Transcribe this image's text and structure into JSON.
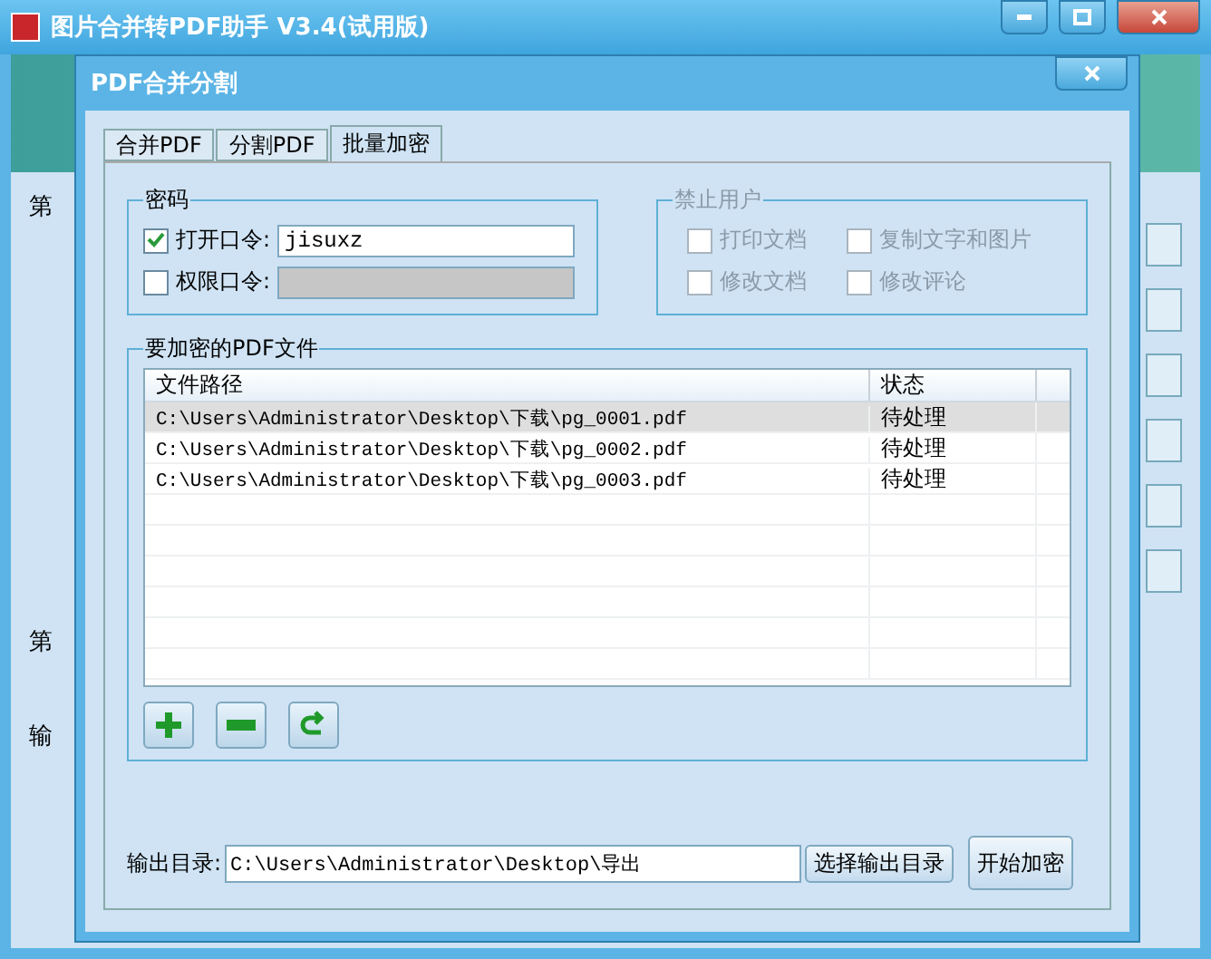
{
  "main_window": {
    "title": "图片合并转PDF助手 V3.4(试用版)",
    "fragments": [
      "第",
      "第",
      "输"
    ]
  },
  "dialog": {
    "title": "PDF合并分割"
  },
  "tabs": [
    {
      "label": "合并PDF",
      "selected": false
    },
    {
      "label": "分割PDF",
      "selected": false
    },
    {
      "label": "批量加密",
      "selected": true
    }
  ],
  "password": {
    "title": "密码",
    "fields": [
      {
        "label": "打开口令:",
        "checked": true,
        "value": "jisuxz"
      },
      {
        "label": "权限口令:",
        "checked": false
      }
    ]
  },
  "restrict": {
    "title": "禁止用户",
    "disabled": true,
    "options": [
      {
        "label": "打印文档",
        "checked": false
      },
      {
        "label": "复制文字和图片",
        "checked": false
      },
      {
        "label": "修改文档",
        "checked": false
      },
      {
        "label": "修改评论",
        "checked": false
      }
    ]
  },
  "files": {
    "title": "要加密的PDF文件",
    "columns": [
      "文件路径",
      "状态"
    ],
    "rows": [
      {
        "path": "C:\\Users\\Administrator\\Desktop\\下载\\pg_0001.pdf",
        "status": "待处理",
        "selected": true
      },
      {
        "path": "C:\\Users\\Administrator\\Desktop\\下载\\pg_0002.pdf",
        "status": "待处理",
        "selected": false
      },
      {
        "path": "C:\\Users\\Administrator\\Desktop\\下载\\pg_0003.pdf",
        "status": "待处理",
        "selected": false
      }
    ]
  },
  "output": {
    "label": "输出目录:",
    "value": "C:\\Users\\Administrator\\Desktop\\导出",
    "browse": "选择输出目录",
    "start": "开始加密"
  }
}
